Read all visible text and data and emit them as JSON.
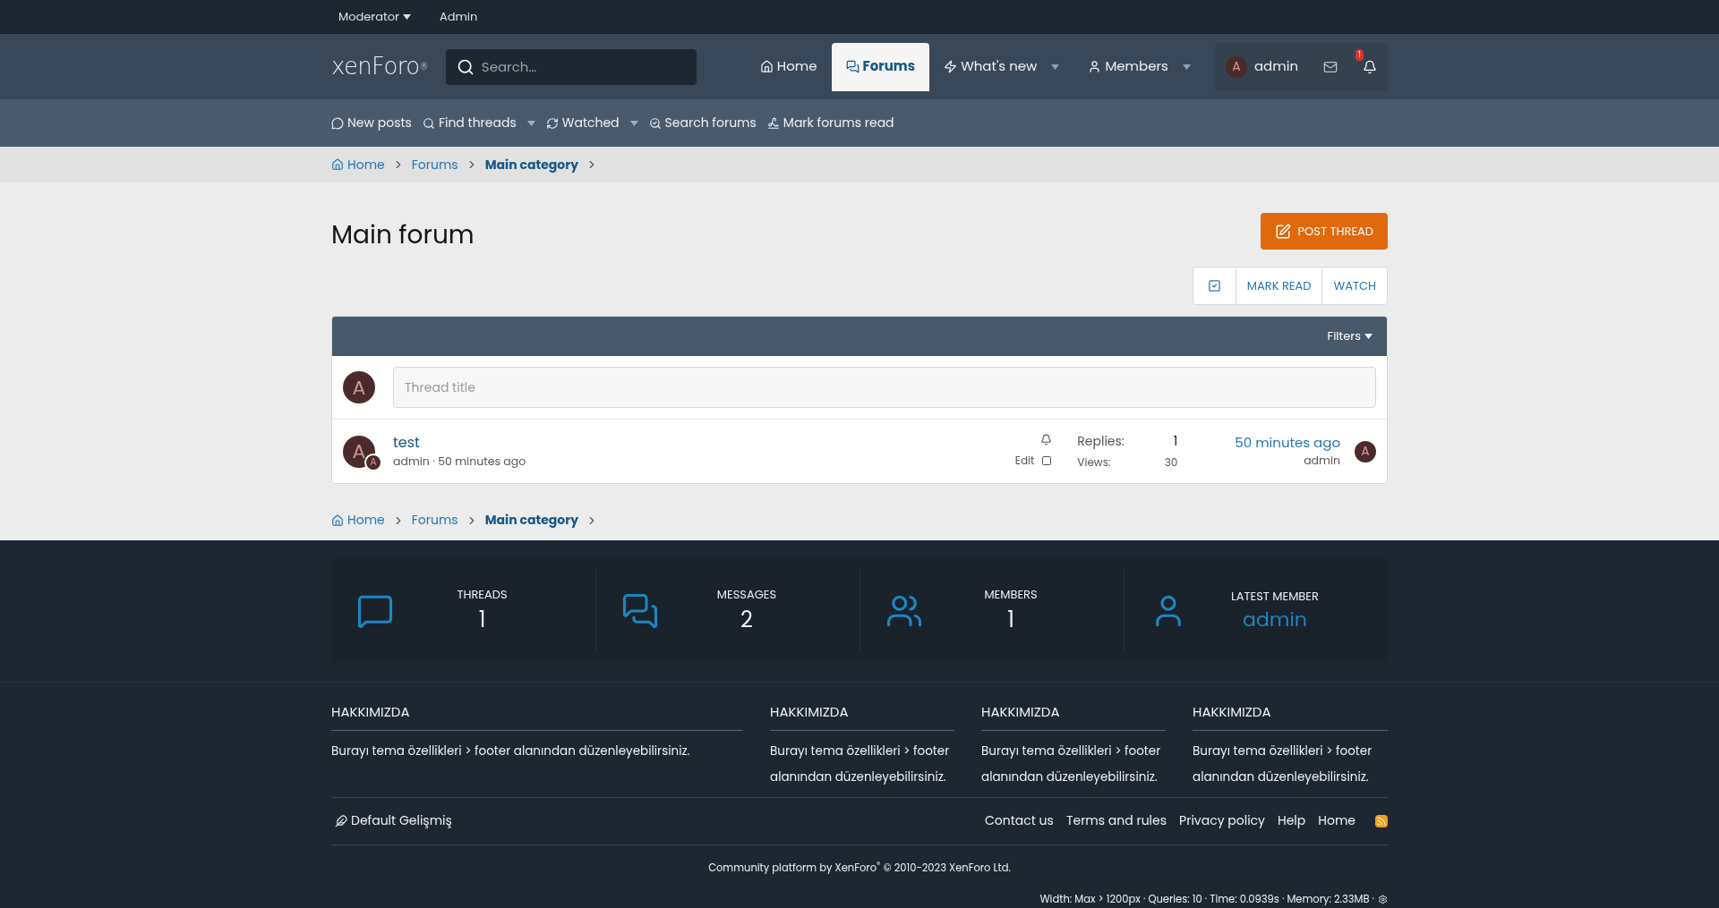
{
  "top_bar": [
    {
      "label": "Moderator",
      "menu": true
    },
    {
      "label": "Admin",
      "menu": false
    }
  ],
  "header": {
    "logo": "xenForo$^{®}$",
    "search": {
      "placeholder": "Search…"
    },
    "nav": [
      {
        "label": "Home",
        "selected": false,
        "menu": false
      },
      {
        "label": "Forums",
        "selected": true,
        "menu": false
      },
      {
        "label": "What's new",
        "selected": false,
        "menu": true
      },
      {
        "label": "Members",
        "selected": false,
        "menu": true
      }
    ],
    "user": {
      "avatar": "A",
      "name": "admin",
      "alerts": "1"
    }
  },
  "sub_nav": [
    {
      "label": "New posts",
      "menu": false
    },
    {
      "label": "Find threads",
      "menu": true
    },
    {
      "label": "Watched",
      "menu": true
    },
    {
      "label": "Search forums",
      "menu": false
    },
    {
      "label": "Mark forums read",
      "menu": false
    }
  ],
  "breadcrumb": [
    {
      "label": "Home",
      "current": false
    },
    {
      "label": "Forums",
      "current": false
    },
    {
      "label": "Main category",
      "current": true
    }
  ],
  "title": "Main forum",
  "post_button": "POST THREAD",
  "actions": [
    "MARK READ",
    "WATCH"
  ],
  "filters": "Filters",
  "new_thread": {
    "avatar": "A",
    "placeholder": "Thread title"
  },
  "threads": [
    {
      "avatar": "A",
      "badge": "A",
      "title": "test",
      "meta": "admin · 50 minutes ago",
      "edit": "Edit",
      "selected": false,
      "replies_label": "Replies:",
      "replies": "1",
      "views_label": "Views:",
      "views": "30",
      "last_time": "50 minutes ago",
      "last_user": "admin",
      "last_avatar": "A"
    }
  ],
  "breadcrumb_bottom": [
    {
      "label": "Home",
      "current": false
    },
    {
      "label": "Forums",
      "current": false
    },
    {
      "label": "Main category",
      "current": true
    }
  ],
  "stats": [
    {
      "label": "THREADS",
      "value": "1",
      "kind": "count"
    },
    {
      "label": "MESSAGES",
      "value": "2",
      "kind": "count"
    },
    {
      "label": "MEMBERS",
      "value": "1",
      "kind": "count"
    },
    {
      "label": "LATEST MEMBER",
      "value": "admin",
      "kind": "link"
    }
  ],
  "footer_columns": [
    {
      "heading": "HAKKIMIZDA",
      "text": "Burayı tema özellikleri > footer alanından düzenleyebilirsiniz."
    },
    {
      "heading": "HAKKIMIZDA",
      "text": "Burayı tema özellikleri > footer alanından düzenleyebilirsiniz."
    },
    {
      "heading": "HAKKIMIZDA",
      "text": "Burayı tema özellikleri > footer alanından düzenleyebilirsiniz."
    },
    {
      "heading": "HAKKIMIZDA",
      "text": "Burayı tema özellikleri > footer alanından düzenleyebilirsiniz."
    }
  ],
  "style_chooser": "Default Gelişmiş",
  "footer_links": [
    "Contact us",
    "Terms and rules",
    "Privacy policy",
    "Help",
    "Home"
  ],
  "copyright": "Community platform by XenForo$^{®}$ © 2010-2023 XenForo Ltd.",
  "debug": "Width: Max > 1200px · Queries: 10 · Time: 0.0939s · Memory: 2.33MB ·"
}
